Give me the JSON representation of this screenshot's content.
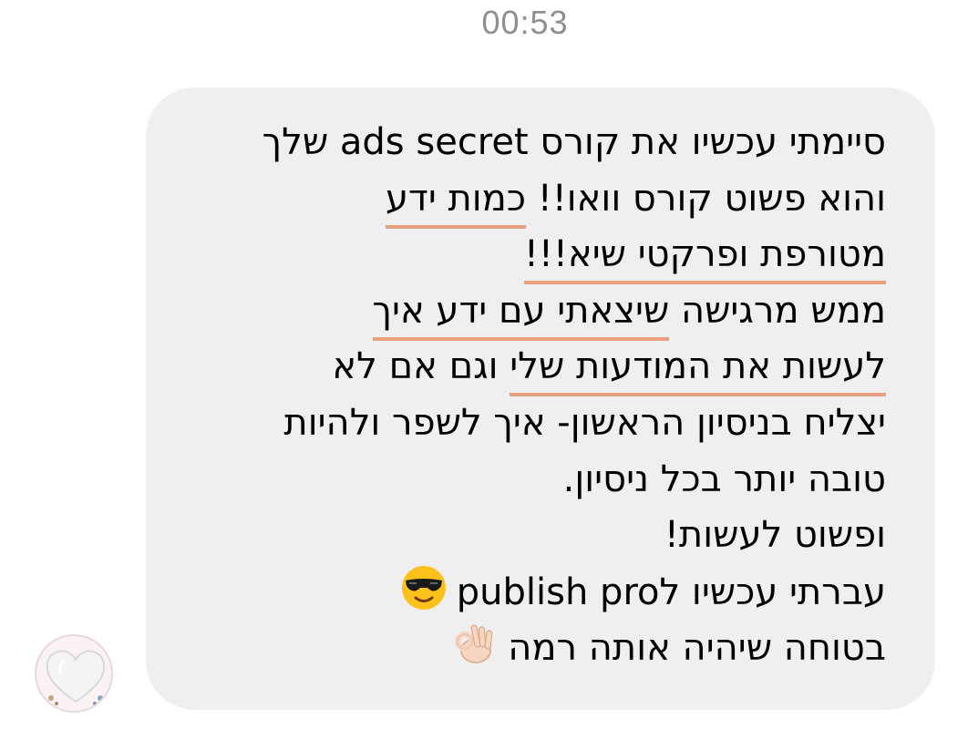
{
  "timestamp": "00:53",
  "message": {
    "line1": "סיימתי עכשיו את קורס ads secret שלך",
    "line2_plain": "והוא פשוט קורס וואו!! ",
    "line2_highlight": "כמות ידע",
    "line3_highlight": "מטורפת ופרקטי שיא!!!",
    "line4_plain": "ממש מרגישה ",
    "line4_highlight": "שיצאתי עם ידע איך",
    "line5_highlight": "לעשות את המודעות שלי",
    "line5_plain": " וגם אם לא",
    "line6": "יצליח בניסיון הראשון- איך לשפר ולהיות",
    "line7": "טובה יותר בכל ניסיון.",
    "line8": "ופשוט לעשות!",
    "line9": "עברתי עכשיו לpublish pro",
    "line10": "בטוחה שיהיה אותה רמה"
  },
  "icons": {
    "line9_emoji": "sunglasses-face-emoji",
    "line10_emoji": "ok-hand-emoji",
    "avatar": "white-heart-avatar"
  },
  "colors": {
    "bubble_background": "#efefef",
    "underline_highlight": "#e8a07e",
    "timestamp_text": "#8e8e93"
  }
}
